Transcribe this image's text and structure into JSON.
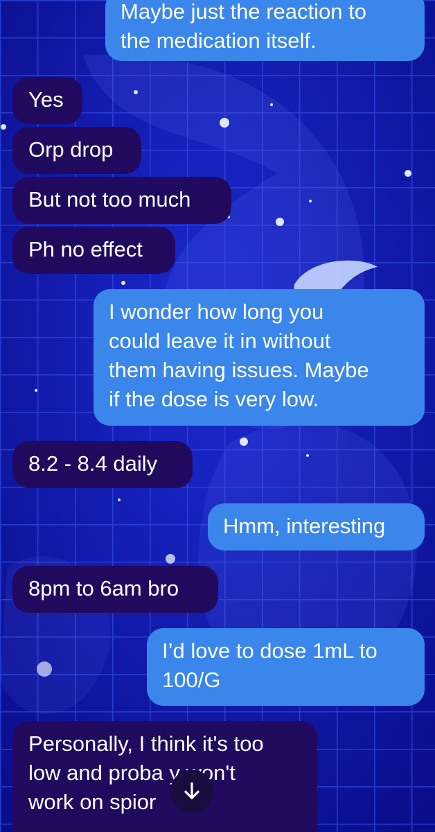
{
  "theme": {
    "incoming_bubble": "#210a5e",
    "outgoing_bubble": "#3a86ea",
    "background": "#0a0f9e"
  },
  "messages": [
    {
      "direction": "outgoing",
      "text": "Maybe just the reaction to\nthe medication itself."
    },
    {
      "direction": "incoming",
      "text": "Yes"
    },
    {
      "direction": "incoming",
      "text": "Orp drop"
    },
    {
      "direction": "incoming",
      "text": "But not too much"
    },
    {
      "direction": "incoming",
      "text": "Ph no effect"
    },
    {
      "direction": "outgoing",
      "text": "I wonder how long you\ncould leave it in without\nthem having issues. Maybe\nif the dose is very low."
    },
    {
      "direction": "incoming",
      "text": "8.2 - 8.4 daily"
    },
    {
      "direction": "outgoing",
      "text": "Hmm, interesting"
    },
    {
      "direction": "incoming",
      "text": "8pm to 6am bro"
    },
    {
      "direction": "outgoing",
      "text": "I’d love to dose 1mL to\n100/G"
    },
    {
      "direction": "incoming",
      "text": "Personally, I think it's too\nlow and proba  y won't\nwork on spior"
    }
  ],
  "scroll_to_bottom": {
    "icon": "arrow-down-icon"
  }
}
